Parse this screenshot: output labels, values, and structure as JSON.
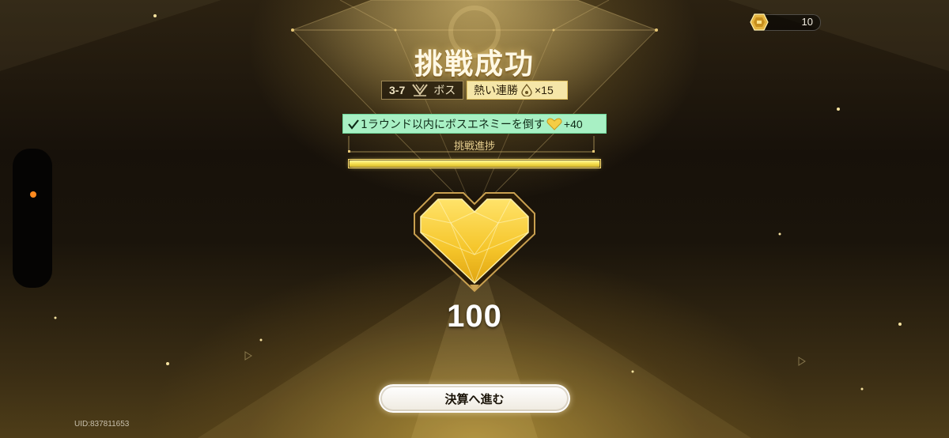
{
  "header": {
    "title": "挑戦成功",
    "currency": {
      "icon": "gold-ticket-icon",
      "value": "10"
    }
  },
  "stage": {
    "number": "3-7",
    "type_icon": "boss-crest-icon",
    "type_label": "ボス",
    "streak_label": "熱い連勝",
    "streak_icon": "flame-drop-icon",
    "streak_multiplier": "×15"
  },
  "objective": {
    "check_icon": "checkmark-icon",
    "text": "1ラウンド以内にボスエネミーを倒す",
    "reward_icon": "heart-icon",
    "reward": "+40"
  },
  "progress": {
    "label": "挑戦進捗",
    "fraction": 1.0
  },
  "result": {
    "icon": "golden-heart-icon",
    "score": "100"
  },
  "footer": {
    "proceed_label": "決算へ進む",
    "uid": "UID:837811653"
  },
  "colors": {
    "objective_bg": "#a8f0c4",
    "streak_bg": "#f5e6a8",
    "progress_fill": "#f5e050",
    "handle_dot": "#ff8a1e"
  }
}
